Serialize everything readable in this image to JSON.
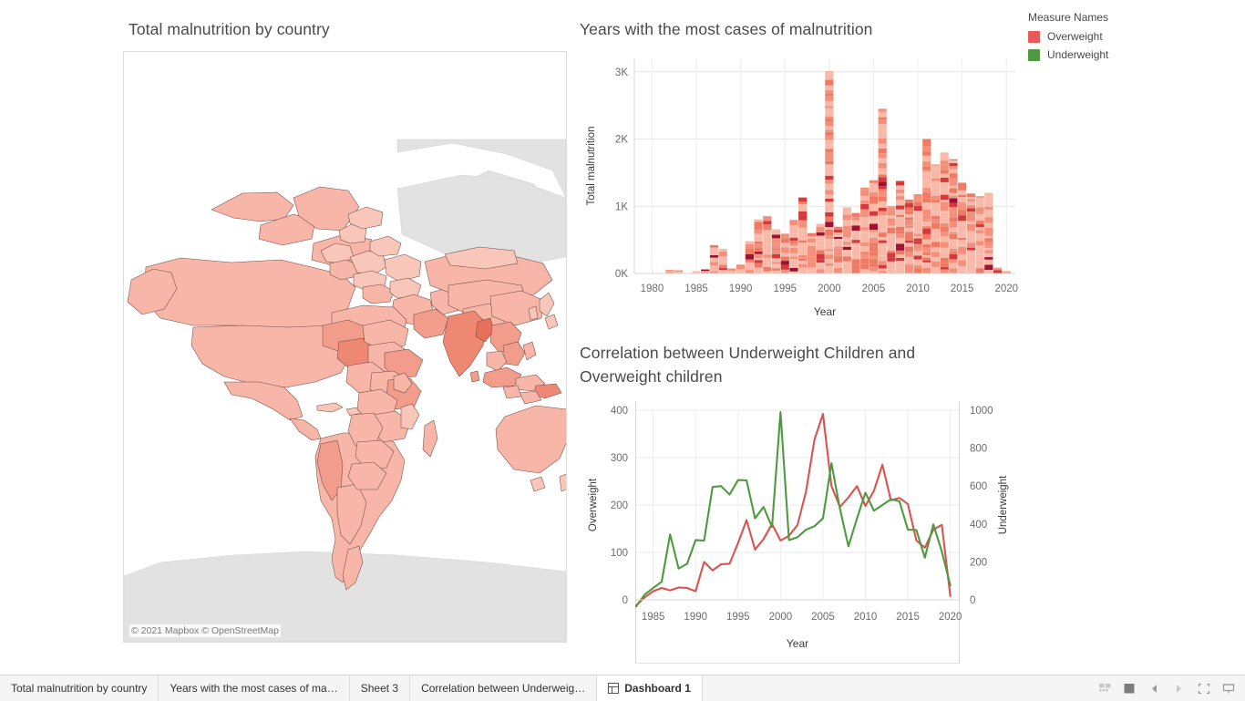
{
  "map": {
    "title": "Total malnutrition by country",
    "attribution": "© 2021 Mapbox © OpenStreetMap"
  },
  "bar": {
    "title": "Years with the most cases of malnutrition"
  },
  "line": {
    "title_line1": "Correlation between Underweight Children and",
    "title_line2": "Overweight children"
  },
  "legend": {
    "title": "Measure Names",
    "items": [
      {
        "label": "Overweight",
        "color": "#e8595a"
      },
      {
        "label": "Underweight",
        "color": "#4e9a40"
      }
    ]
  },
  "taskbar": {
    "tabs": [
      {
        "label": "Total malnutrition by country",
        "active": false,
        "icon": ""
      },
      {
        "label": "Years with the most cases of ma…",
        "active": false,
        "icon": ""
      },
      {
        "label": "Sheet 3",
        "active": false,
        "icon": ""
      },
      {
        "label": "Correlation between Underweig…",
        "active": false,
        "icon": ""
      },
      {
        "label": "Dashboard 1",
        "active": true,
        "icon": "dashboard-grid-icon"
      }
    ],
    "status_icons": [
      "tiles-view-icon",
      "filled-square-icon",
      "previous-arrow-icon",
      "next-arrow-icon",
      "fullscreen-icon",
      "presentation-icon"
    ]
  },
  "chart_data": [
    {
      "type": "bar",
      "name": "years-with-most-cases-of-malnutrition",
      "title": "Years with the most cases of malnutrition",
      "xlabel": "Year",
      "ylabel": "Total malnutrition",
      "xlim": [
        1978,
        2021
      ],
      "ylim": [
        0,
        3200
      ],
      "xticks": [
        1980,
        1985,
        1990,
        1995,
        2000,
        2005,
        2010,
        2015,
        2020
      ],
      "yticks": [
        0,
        1000,
        2000,
        3000
      ],
      "ytick_labels": [
        "0K",
        "1K",
        "2K",
        "3K"
      ],
      "grid": "horizontal-and-vertical",
      "note": "stacked bars, each segment a country, colored by Total malnutrition value",
      "categories": [
        1980,
        1981,
        1982,
        1983,
        1984,
        1985,
        1986,
        1987,
        1988,
        1989,
        1990,
        1991,
        1992,
        1993,
        1994,
        1995,
        1996,
        1997,
        1998,
        1999,
        2000,
        2001,
        2002,
        2003,
        2004,
        2005,
        2006,
        2007,
        2008,
        2009,
        2010,
        2011,
        2012,
        2013,
        2014,
        2015,
        2016,
        2017,
        2018,
        2019,
        2020
      ],
      "values": [
        0,
        0,
        60,
        55,
        0,
        35,
        60,
        430,
        400,
        80,
        130,
        480,
        880,
        900,
        700,
        590,
        800,
        1150,
        600,
        740,
        3120,
        730,
        1000,
        900,
        1280,
        1390,
        2450,
        1000,
        1380,
        1100,
        1180,
        2000,
        1620,
        1800,
        1700,
        1360,
        1210,
        1150,
        1200,
        90,
        40
      ]
    },
    {
      "type": "line",
      "name": "correlation-underweight-overweight",
      "title": "Correlation between Underweight Children and Overweight children",
      "xlabel": "Year",
      "y_left_label": "Overweight",
      "y_right_label": "Underweight",
      "xlim": [
        1983,
        2021
      ],
      "y_left_lim": [
        0,
        400
      ],
      "y_right_lim": [
        0,
        1000
      ],
      "xticks": [
        1985,
        1990,
        1995,
        2000,
        2005,
        2010,
        2015,
        2020
      ],
      "y_left_ticks": [
        0,
        100,
        200,
        300,
        400
      ],
      "y_right_ticks": [
        0,
        200,
        400,
        600,
        800,
        1000
      ],
      "grid": "horizontal-and-vertical",
      "x": [
        1983,
        1984,
        1985,
        1986,
        1987,
        1988,
        1989,
        1990,
        1991,
        1992,
        1993,
        1994,
        1995,
        1996,
        1997,
        1998,
        1999,
        2000,
        2001,
        2002,
        2003,
        2004,
        2005,
        2006,
        2007,
        2008,
        2009,
        2010,
        2011,
        2012,
        2013,
        2014,
        2015,
        2016,
        2017,
        2018,
        2019,
        2020
      ],
      "series": [
        {
          "name": "Overweight",
          "color": "#d9534f",
          "axis": "left",
          "values": [
            -12,
            5,
            18,
            25,
            20,
            26,
            25,
            18,
            80,
            62,
            75,
            76,
            120,
            168,
            106,
            128,
            160,
            125,
            135,
            158,
            228,
            338,
            392,
            240,
            196,
            216,
            240,
            198,
            230,
            285,
            210,
            215,
            202,
            125,
            110,
            148,
            158,
            8
          ]
        },
        {
          "name": "Underweight",
          "color": "#4e9a40",
          "axis": "right",
          "values": [
            -35,
            28,
            62,
            95,
            345,
            165,
            190,
            315,
            312,
            595,
            600,
            555,
            632,
            630,
            430,
            490,
            384,
            990,
            315,
            330,
            370,
            388,
            430,
            720,
            480,
            282,
            428,
            565,
            470,
            500,
            530,
            520,
            370,
            368,
            222,
            398,
            255,
            75
          ]
        }
      ]
    }
  ]
}
